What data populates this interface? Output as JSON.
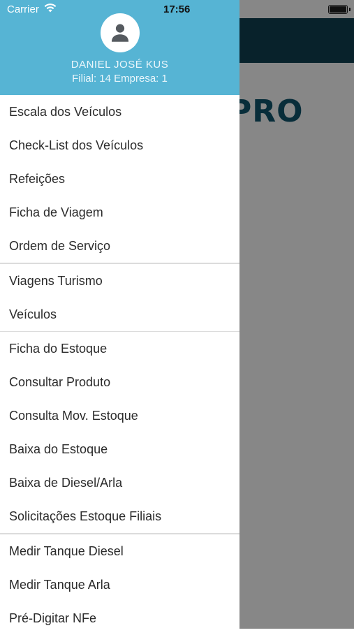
{
  "status_bar": {
    "carrier": "Carrier",
    "time": "17:56"
  },
  "background_app": {
    "logo_text": "PRO"
  },
  "drawer": {
    "header": {
      "user_name": "DANIEL JOSÉ KUS",
      "user_info": "Filial: 14 Empresa: 1"
    },
    "groups": [
      [
        "Escala dos Veículos",
        "Check-List dos Veículos",
        "Refeições",
        "Ficha de Viagem",
        "Ordem de Serviço"
      ],
      [
        "Viagens Turismo",
        "Veículos"
      ],
      [
        "Ficha do Estoque",
        "Consultar Produto",
        "Consulta Mov. Estoque",
        "Baixa do Estoque",
        "Baixa de Diesel/Arla",
        "Solicitações Estoque Filiais"
      ],
      [
        "Medir Tanque Diesel",
        "Medir Tanque Arla",
        "Pré-Digitar NFe"
      ]
    ]
  },
  "colors": {
    "header_bg": "#56b4d4",
    "app_header_bg": "#0f3b4a",
    "logo": "#0f4f64"
  }
}
